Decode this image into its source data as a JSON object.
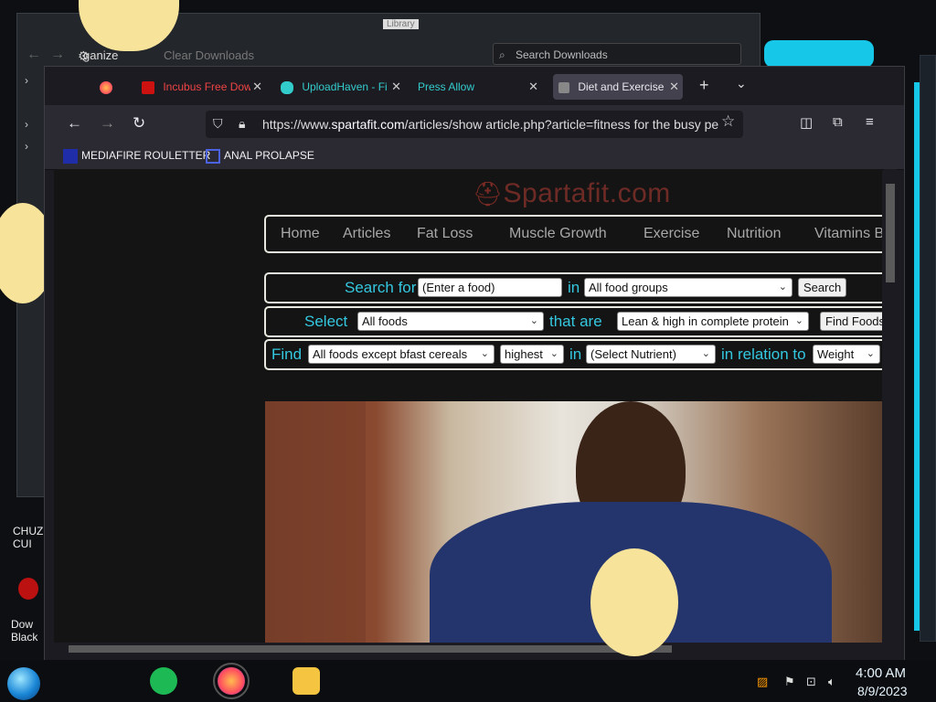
{
  "library": {
    "title": "Library",
    "organize": "ganize",
    "clear_downloads": "Clear Downloads",
    "search_placeholder": "Search Downloads"
  },
  "tabs": [
    {
      "label": "Incubus Free Dow"
    },
    {
      "label": "UploadHaven - Fi"
    },
    {
      "label": "Press Allow"
    },
    {
      "label": "Diet and Exercise,"
    }
  ],
  "url": {
    "prefix": "https://www.",
    "host": "spartafit.com",
    "path": "/articles/show article.php?article=fitness for the busy pe"
  },
  "bookmarks": [
    {
      "label": "MEDIAFIRE ROULETTER",
      "icon": "mediafire-icon"
    },
    {
      "label": "ANAL PROLAPSE",
      "icon": "bookmark-folder-icon"
    }
  ],
  "site": {
    "logo": "Spartafit.com",
    "nav": [
      "Home",
      "Articles",
      "Fat Loss",
      "Muscle Growth",
      "Exercise",
      "Nutrition",
      "Vitamins B"
    ]
  },
  "tools": {
    "row1": {
      "label": "Search for",
      "input_value": "(Enter a food)",
      "in_label": "in",
      "group_select": "All food groups",
      "button": "Search"
    },
    "row2": {
      "label": "Select",
      "select1": "All foods",
      "that_are": "that are",
      "select2": "Lean & high in complete protein",
      "button": "Find Foods"
    },
    "row3": {
      "label": "Find",
      "select1": "All foods except bfast cereals",
      "select2": "highest",
      "in_label": "in",
      "select3": "(Select Nutrient)",
      "relation_label": "in relation to",
      "select4": "Weight"
    }
  },
  "desktop": {
    "icon1_label": "CHUZ\nCUI",
    "icon2_label": "Dow\nBlack"
  },
  "taskbar": {
    "time": "4:00 AM",
    "date": "8/9/2023"
  },
  "colors": {
    "accent_cyan": "#16c7e8",
    "site_label_cyan": "#34c8e0",
    "logo_red": "#6e2b26"
  }
}
